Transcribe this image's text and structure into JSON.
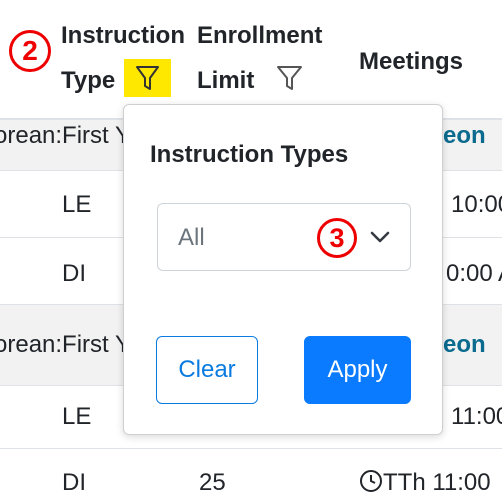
{
  "header": {
    "col_instruction_type": [
      "Instruction",
      "Type"
    ],
    "col_enrollment_limit": [
      "Enrollment",
      "Limit"
    ],
    "col_meetings": "Meetings",
    "step_badge": "2"
  },
  "rows": [
    {
      "kind": "group",
      "text": "orean:First Y",
      "meet": "eon"
    },
    {
      "kind": "data",
      "type": "LE",
      "limit": "",
      "meet": "10:00"
    },
    {
      "kind": "data",
      "type": "DI",
      "limit": "",
      "meet": "0:00 A"
    },
    {
      "kind": "group",
      "text": "orean:First Y",
      "meet": "eon"
    },
    {
      "kind": "data",
      "type": "LE",
      "limit": "",
      "meet": "11:00"
    },
    {
      "kind": "data",
      "type": "DI",
      "limit": "25",
      "meet": "TTh 11:00"
    }
  ],
  "popup": {
    "title": "Instruction Types",
    "select_value": "All",
    "step_badge": "3",
    "clear_label": "Clear",
    "apply_label": "Apply"
  },
  "colors": {
    "highlight": "#ffe800",
    "badge_red": "#ee0000",
    "primary_blue": "#0a7bff",
    "link_teal": "#0a6b8f"
  },
  "icons": [
    "filter-icon",
    "chevron-down-icon",
    "clock-icon"
  ]
}
